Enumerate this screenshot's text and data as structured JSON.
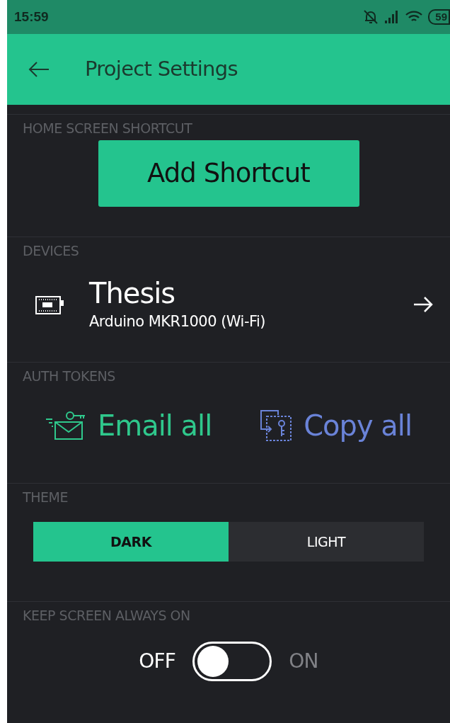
{
  "status_bar": {
    "time": "15:59",
    "battery": "59"
  },
  "header": {
    "title": "Project Settings"
  },
  "sections": [
    {
      "kind": "shortcut",
      "title": "HOME SCREEN SHORTCUT",
      "button": "Add Shortcut"
    },
    {
      "kind": "devices",
      "title": "DEVICES",
      "device": {
        "name": "Thesis",
        "model": "Arduino MKR1000 (Wi-Fi)"
      }
    },
    {
      "kind": "tokens",
      "title": "AUTH TOKENS",
      "actions": [
        {
          "kind": "email",
          "label": "Email all",
          "color": "#2fc88c"
        },
        {
          "kind": "copy",
          "label": "Copy all",
          "color": "#6a83d8"
        }
      ]
    },
    {
      "kind": "theme",
      "title": "THEME",
      "options": [
        {
          "label": "DARK",
          "selected": true
        },
        {
          "label": "LIGHT",
          "selected": false
        }
      ]
    },
    {
      "kind": "toggle",
      "title": "KEEP SCREEN ALWAYS ON",
      "off_label": "OFF",
      "on_label": "ON",
      "on": false
    }
  ]
}
